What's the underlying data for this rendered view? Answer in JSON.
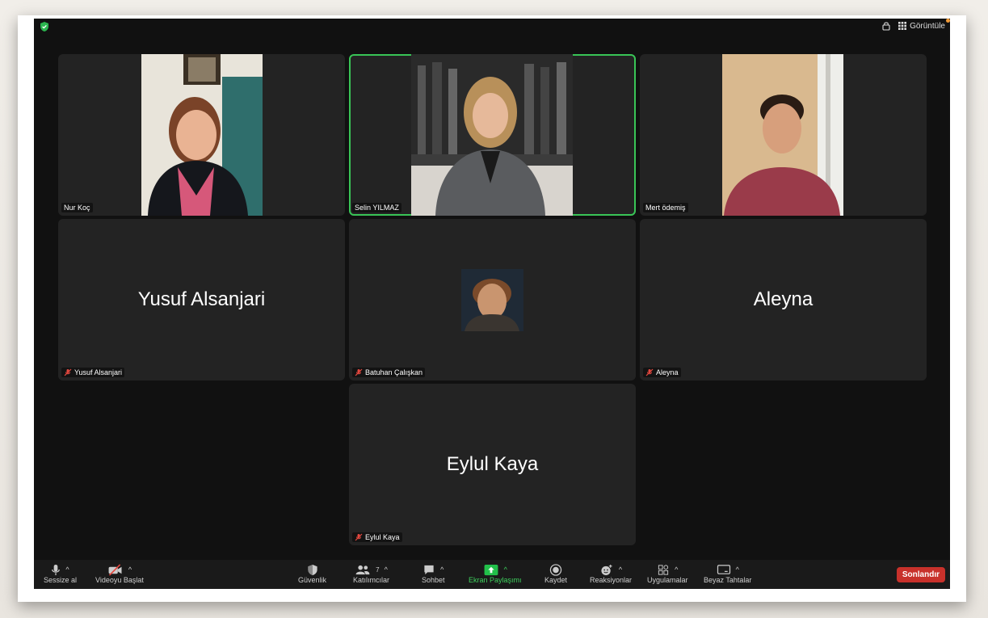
{
  "top_bar": {
    "view_label": "Görüntüle"
  },
  "tiles": [
    {
      "name": "Nur Koç",
      "muted": false,
      "video": true
    },
    {
      "name": "Selin YILMAZ",
      "muted": false,
      "video": true,
      "active_speaker": true
    },
    {
      "name": "Mert ödemiş",
      "muted": false,
      "video": true
    },
    {
      "name": "Yusuf Alsanjari",
      "display": "Yusuf Alsanjari",
      "muted": true,
      "video": false
    },
    {
      "name": "Batuhan Çalışkan",
      "muted": true,
      "video": false,
      "avatar": true
    },
    {
      "name": "Aleyna",
      "display": "Aleyna",
      "muted": true,
      "video": false
    },
    {
      "name": "Eylul Kaya",
      "display": "Eylul Kaya",
      "muted": true,
      "video": false
    }
  ],
  "toolbar": {
    "mute_label": "Sessize al",
    "video_label": "Videoyu Başlat",
    "security_label": "Güvenlik",
    "participants_label": "Katılımcılar",
    "participants_count": "7",
    "chat_label": "Sohbet",
    "share_label": "Ekran Paylaşımı",
    "record_label": "Kaydet",
    "reactions_label": "Reaksiyonlar",
    "apps_label": "Uygulamalar",
    "whiteboard_label": "Beyaz Tahtalar",
    "end_label": "Sonlandır"
  },
  "colors": {
    "active_speaker_border": "#39c456",
    "share_green": "#3ed15d",
    "end_red": "#c8312b",
    "muted_red": "#e5483f"
  }
}
